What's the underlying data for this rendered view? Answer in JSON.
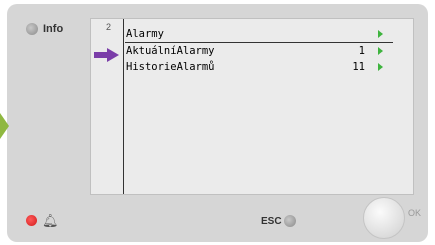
{
  "info": {
    "label": "Info"
  },
  "screen": {
    "page_number": "2",
    "rows": [
      {
        "label": "Alarmy",
        "value": ""
      },
      {
        "label": "AktuálníAlarmy",
        "value": "1"
      },
      {
        "label": "HistorieAlarmů",
        "value": "11"
      }
    ],
    "selected_row": 1
  },
  "controls": {
    "esc_label": "ESC",
    "ok_label": "OK"
  },
  "icons": [
    "side-arrow-icon",
    "pointer-arrow-icon",
    "go-arrow-icon",
    "alarm-led-icon",
    "bell-icon",
    "esc-led-icon"
  ],
  "colors": {
    "pointer": "#7a3da8",
    "go_arrow": "#3fb43f",
    "side_arrow": "#8fb840",
    "alarm_led": "#d21c1c"
  }
}
